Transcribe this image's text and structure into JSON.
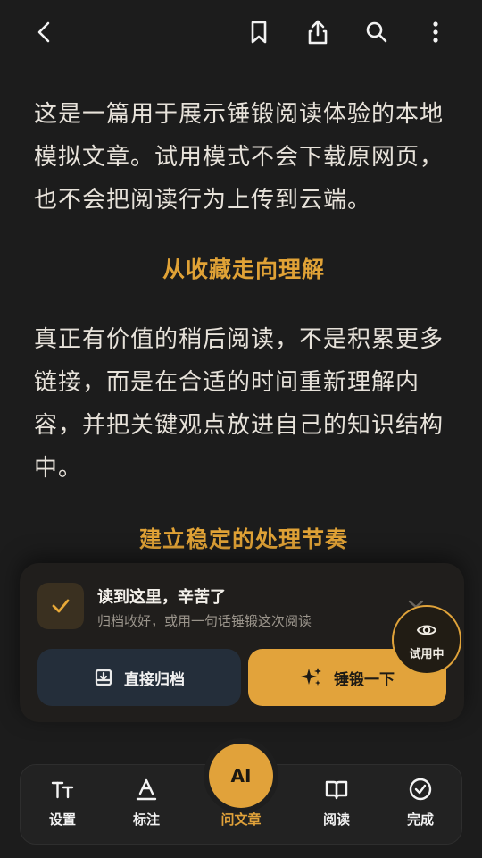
{
  "topbar": {
    "icons": [
      "back-arrow-icon",
      "bookmark-icon",
      "share-icon",
      "search-icon",
      "more-vertical-icon"
    ]
  },
  "article": {
    "paragraph_1": "这是一篇用于展示锤锻阅读体验的本地模拟文章。试用模式不会下载原网页，也不会把阅读行为上传到云端。",
    "heading_1": "从收藏走向理解",
    "paragraph_2": "真正有价值的稍后阅读，不是积累更多链接，而是在合适的时间重新理解内容，并把关键观点放进自己的知识结构中。",
    "heading_2": "建立稳定的处理节奏"
  },
  "finish_card": {
    "title": "读到这里，辛苦了",
    "subtitle": "归档收好，或用一句话锤锻这次阅读",
    "archive_label": "直接归档",
    "forge_label": "锤锻一下"
  },
  "trial_badge": {
    "label": "试用中"
  },
  "bottom_nav": {
    "settings": "设置",
    "annotate": "标注",
    "ai_button": "AI",
    "ask_article": "问文章",
    "read": "阅读",
    "done": "完成"
  },
  "colors": {
    "accent": "#e1a23a",
    "background": "#1c1c1c",
    "archive_button": "#242e3a"
  }
}
